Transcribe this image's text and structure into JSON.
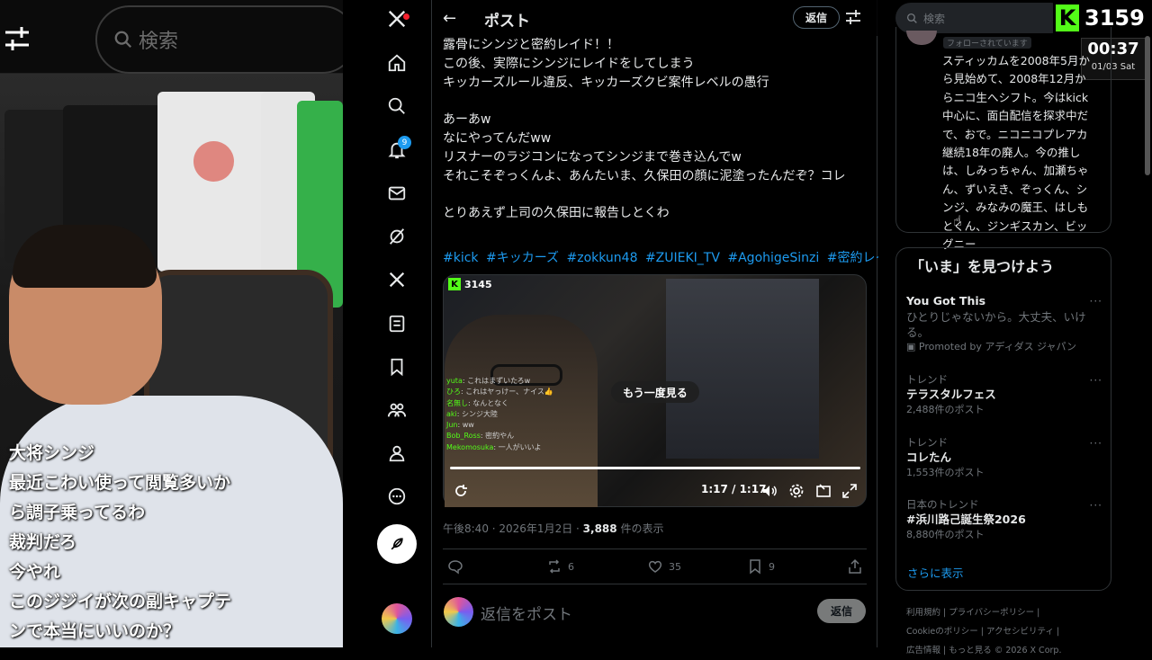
{
  "left_panel": {
    "search_label": "検索",
    "comments": [
      "大将シンジ",
      "最近こわい使って閲覧多いか",
      "ら調子乗ってるわ",
      "裁判だろ",
      "今やれ",
      "このジジイが次の副キャプテ",
      "ンで本当にいいのか？"
    ]
  },
  "nav": {
    "notification_count": "9"
  },
  "header": {
    "title": "ポスト",
    "reply_label": "返信"
  },
  "post": {
    "lines": [
      "露骨にシンジと密約レイド！！",
      "この後、実際にシンジにレイドをしてしまう",
      "キッカーズルール違反、キッカーズクビ案件レベルの愚行",
      "",
      "あーあw",
      "なにやってんだww",
      "リスナーのラジコンになってシンジまで巻き込んでw",
      "それこそぞっくんよ、あんたいま、久保田の顔に泥塗ったんだぞ？コレ",
      "",
      "とりあえず上司の久保田に報告しとくわ"
    ],
    "hashtags": [
      "#kick",
      "#キッカーズ",
      "#zokkun48",
      "#ZUIEKI_TV",
      "#AgohigeSinzi",
      "#密約レイド"
    ],
    "video": {
      "viewer_count": "3145",
      "replay_label": "もう一度見る",
      "time": "1:17 / 1:17",
      "progress": 1.0,
      "chat": [
        {
          "user": "yuta",
          "text": "これはまずいたろw"
        },
        {
          "user": "ひろ",
          "text": "これはヤっけー、ナイス👍"
        },
        {
          "user": "名無し",
          "text": "なんとなく"
        },
        {
          "user": "aki",
          "text": "シンジ大陸"
        },
        {
          "user": "Jun",
          "text": "ww"
        },
        {
          "user": "Bob_Ross",
          "text": "密約やん"
        },
        {
          "user": "Mekomosuka",
          "text": "一人がいいよ"
        }
      ]
    },
    "timestamp": "午後8:40 · 2026年1月2日 · ",
    "views_count": "3,888",
    "views_label": " 件の表示",
    "actions": {
      "reposts": "6",
      "likes": "35",
      "bookmarks": "9"
    },
    "reply_placeholder": "返信をポスト",
    "reply_button": "返信"
  },
  "right": {
    "search_placeholder": "検索",
    "kick_viewers": "3159",
    "clock_time": "00:37",
    "clock_date": "01/03 Sat",
    "follows_badge": "フォローされています",
    "bio": "スティッカムを2008年5月から見始めて、2008年12月からニコ生へシフト。今はkick中心に、面白配信を探求中だで、おで。ニコニコプレアカ継続18年の廃人。今の推しは、しみっちゃん、加瀬ちゃん、ずいえき、ぞっくん、シンジ、みなみの魔王、はしもとくん、ジンギスカン、ビッグニー",
    "trends_title": "「いま」を見つけよう",
    "trends": [
      {
        "context": "",
        "name": "You Got This",
        "desc": "ひとりじゃないから。大丈夫、いける。",
        "count": "",
        "promoted": "Promoted by アディダス ジャパン"
      },
      {
        "context": "トレンド",
        "name": "テラスタルフェス",
        "count": "2,488件のポスト"
      },
      {
        "context": "トレンド",
        "name": "コレたん",
        "count": "1,553件のポスト"
      },
      {
        "context": "日本のトレンド",
        "name": "#浜川路己誕生祭2026",
        "count": "8,880件のポスト"
      }
    ],
    "show_more": "さらに表示",
    "footer_links": [
      "利用規約",
      "プライバシーポリシー",
      "Cookieのポリシー",
      "アクセシビリティ",
      "広告情報",
      "もっと見る",
      "© 2026 X Corp."
    ]
  },
  "colors": {
    "accent": "#1d9bf0",
    "kick_green": "#53fc18",
    "background": "#000000",
    "border": "#2f3336"
  }
}
